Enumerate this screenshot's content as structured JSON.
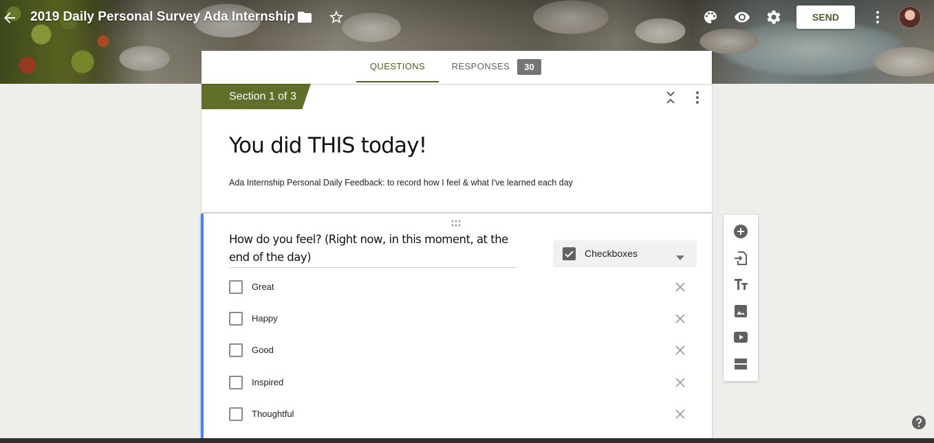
{
  "header": {
    "title": "2019 Daily Personal Survey Ada Internship",
    "send_label": "SEND",
    "icons": [
      "arrow-back-icon",
      "folder-icon",
      "star-icon",
      "palette-icon",
      "eye-icon",
      "gear-icon",
      "more-vert-icon"
    ]
  },
  "tabs": {
    "questions_label": "QUESTIONS",
    "responses_label": "RESPONSES",
    "responses_count": "30"
  },
  "section": {
    "label": "Section 1 of 3",
    "form_title": "You did THIS today!",
    "form_description": "Ada Internship Personal Daily Feedback: to record how I feel & what I've learned each day"
  },
  "question": {
    "title": "How do you feel? (Right now, in this moment, at the end of the day)",
    "type_label": "Checkboxes",
    "options": [
      "Great",
      "Happy",
      "Good",
      "Inspired",
      "Thoughtful"
    ]
  },
  "toolbar": {
    "icons": [
      "add-question-icon",
      "import-questions-icon",
      "title-text-icon",
      "image-icon",
      "video-icon",
      "section-icon"
    ]
  },
  "colors": {
    "accent": "#4d5c23",
    "section_tag": "#5f6f2a",
    "active_question_border": "#4285f4",
    "page_background": "#eeeeea"
  }
}
